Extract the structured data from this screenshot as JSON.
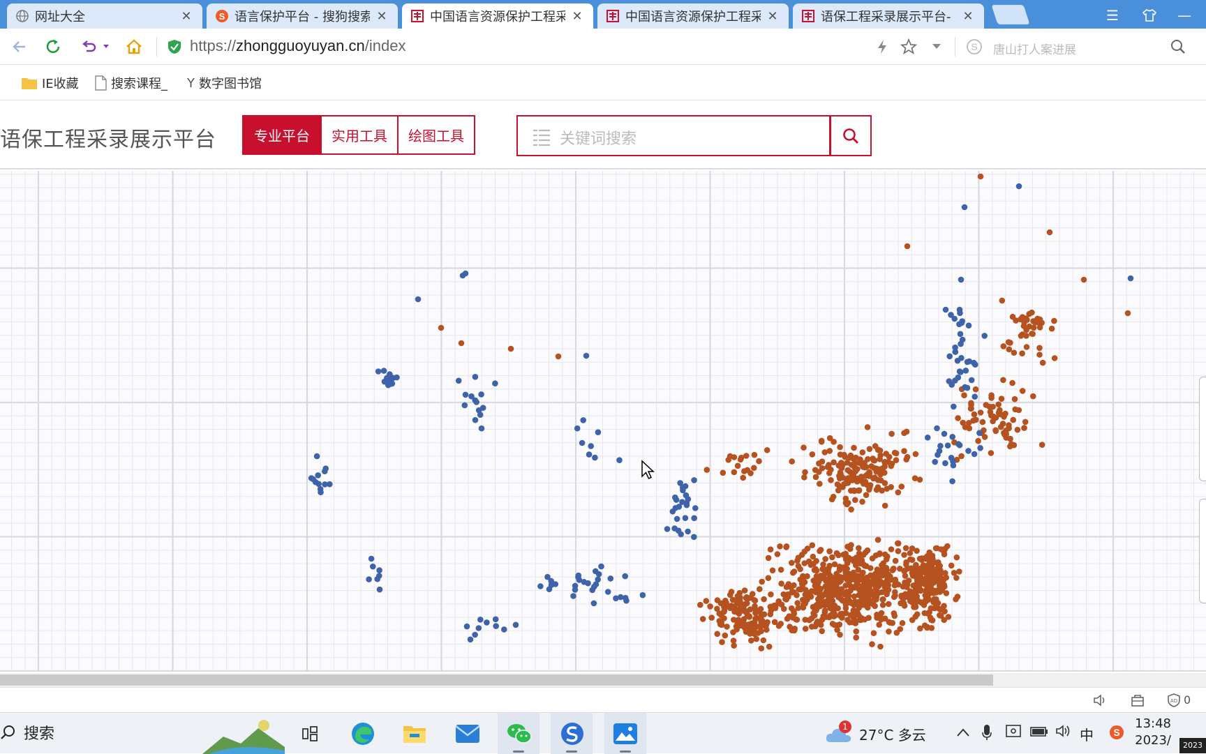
{
  "tabs": [
    {
      "title": "网址大全",
      "icon": "globe-icon"
    },
    {
      "title": "语言保护平台 - 搜狗搜索",
      "icon": "sogou-icon"
    },
    {
      "title": "中国语言资源保护工程采录展示平台",
      "icon": "yubao-icon",
      "active": true
    },
    {
      "title": "中国语言资源保护工程采录展示平台",
      "icon": "yubao-icon"
    },
    {
      "title": "语保工程采录展示平台-",
      "icon": "yubao-icon"
    }
  ],
  "address": {
    "scheme": "https://",
    "host": "zhongguoyuyan.cn",
    "path": "/index",
    "search_placeholder": "唐山打人案进展"
  },
  "bookmarks": [
    {
      "label": "IE收藏",
      "icon": "folder-icon"
    },
    {
      "label": "搜索课程_",
      "icon": "page-icon"
    },
    {
      "label": "数字图书馆",
      "icon": "y-icon"
    }
  ],
  "site": {
    "title": "语保工程采录展示平台",
    "nav": [
      "专业平台",
      "实用工具",
      "绘图工具"
    ],
    "search_placeholder": "关键词搜索"
  },
  "plot": {
    "series_colors": {
      "orange": "#b5521f",
      "blue": "#3f63a8"
    },
    "grid_color": "#d9d9e3"
  },
  "status": {
    "ad_count": "0"
  },
  "taskbar": {
    "search_label": "搜索",
    "weather": "27°C 多云",
    "weather_badge": "1",
    "ime": "中",
    "time": "13:48",
    "date": "2023/",
    "corner": "2023"
  }
}
